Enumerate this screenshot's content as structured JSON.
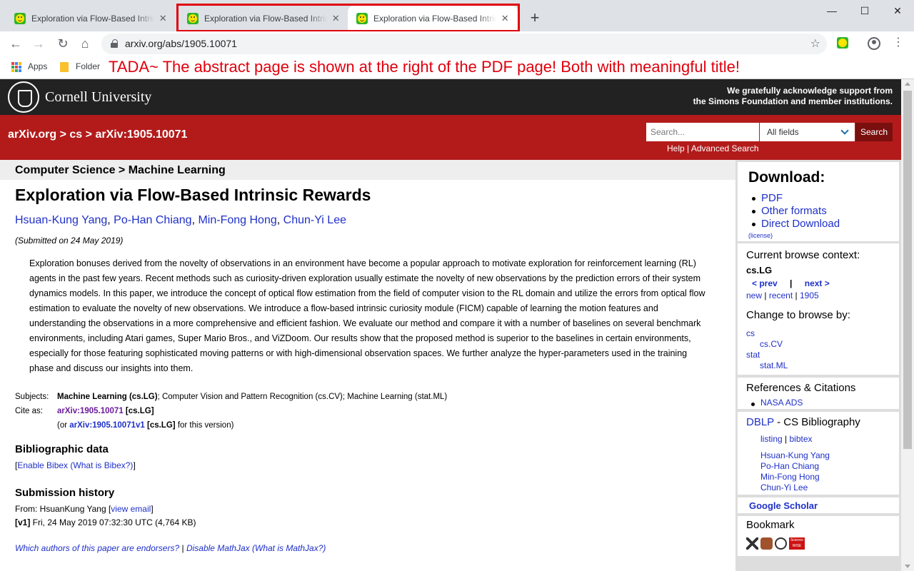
{
  "browser": {
    "tabs": [
      {
        "title": "Exploration via Flow-Based Intrinsic Rewards"
      },
      {
        "title": "Exploration via Flow-Based Intrinsic Rewards"
      },
      {
        "title": "Exploration via Flow-Based Intrinsic Rewards"
      }
    ],
    "new_tab": "+",
    "url": "arxiv.org/abs/1905.10071",
    "bookmarks": [
      {
        "label": "Apps"
      },
      {
        "label": "Folder"
      }
    ],
    "annotation": "TADA~ The abstract page is shown at the right of the PDF page! Both with meaningful title!"
  },
  "header": {
    "brand": "Cornell University",
    "ack_line1": "We gratefully acknowledge support from",
    "ack_line2": "the Simons Foundation and member institutions.",
    "breadcrumb": "arXiv.org > cs > arXiv:1905.10071",
    "search_placeholder": "Search...",
    "field_select": "All fields",
    "search_button": "Search",
    "help": "Help",
    "sep": "|",
    "advanced": "Advanced Search"
  },
  "paper": {
    "subject_path": "Computer Science > Machine Learning",
    "title": "Exploration via Flow-Based Intrinsic Rewards",
    "authors": [
      "Hsuan-Kung Yang",
      "Po-Han Chiang",
      "Min-Fong Hong",
      "Chun-Yi Lee"
    ],
    "submitted": "(Submitted on 24 May 2019)",
    "abstract": "Exploration bonuses derived from the novelty of observations in an environment have become a popular approach to motivate exploration for reinforcement learning (RL) agents in the past few years. Recent methods such as curiosity-driven exploration usually estimate the novelty of new observations by the prediction errors of their system dynamics models. In this paper, we introduce the concept of optical flow estimation from the field of computer vision to the RL domain and utilize the errors from optical flow estimation to evaluate the novelty of new observations. We introduce a flow-based intrinsic curiosity module (FICM) capable of learning the motion features and understanding the observations in a more comprehensive and efficient fashion. We evaluate our method and compare it with a number of baselines on several benchmark environments, including Atari games, Super Mario Bros., and ViZDoom. Our results show that the proposed method is superior to the baselines in certain environments, especially for those featuring sophisticated moving patterns or with high-dimensional observation spaces. We further analyze the hyper-parameters used in the training phase and discuss our insights into them.",
    "subjects_label": "Subjects:",
    "subjects_primary": "Machine Learning (cs.LG)",
    "subjects_rest": "; Computer Vision and Pattern Recognition (cs.CV); Machine Learning (stat.ML)",
    "cite_label": "Cite as:",
    "cite_id": "arXiv:1905.10071",
    "cite_cat": "[cs.LG]",
    "cite_or": "(or",
    "cite_v1": "arXiv:1905.10071v1",
    "cite_v1_tail": "for this version)",
    "biblio_heading": "Bibliographic data",
    "bibex_open": "[",
    "enable_bibex": "Enable Bibex",
    "what_bibex": "(What is Bibex?)",
    "bibex_close": "]",
    "history_heading": "Submission history",
    "from_text": "From: HsuanKung Yang [",
    "view_email": "view email",
    "from_close": "]",
    "v1_label": "[v1]",
    "v1_text": " Fri, 24 May 2019 07:32:30 UTC (4,764 KB)",
    "endorsers": "Which authors of this paper are endorsers?",
    "pipe": "|",
    "disable_mathjax": "Disable MathJax",
    "what_mathjax": "(What is MathJax?)"
  },
  "sidebar": {
    "download_title": "Download:",
    "downloads": [
      "PDF",
      "Other formats",
      "Direct Download"
    ],
    "license": "(license)",
    "context_title": "Current browse context:",
    "context": "cs.LG",
    "prev": "< prev",
    "nav_sep": "|",
    "next": "next >",
    "new": "new",
    "recent": "recent",
    "year": "1905",
    "change_title": "Change to browse by:",
    "browse_cs": "cs",
    "browse_cscv": "cs.CV",
    "browse_stat": "stat",
    "browse_statml": "stat.ML",
    "refs_title": "References & Citations",
    "nasa": "NASA ADS",
    "dblp": "DBLP",
    "dblp_rest": " - CS Bibliography",
    "listing": "listing",
    "bibtex": "bibtex",
    "dblp_authors": [
      "Hsuan-Kung Yang",
      "Po-Han Chiang",
      "Min-Fong Hong",
      "Chun-Yi Lee"
    ],
    "scholar": "Google Scholar",
    "bookmark_title": "Bookmark",
    "sciencewise": "Science WISE"
  },
  "colors": {
    "arxiv_red": "#b31b1b",
    "cornell_black": "#222222",
    "link_blue": "#1f30c8",
    "annotation_red": "#e0000d"
  }
}
